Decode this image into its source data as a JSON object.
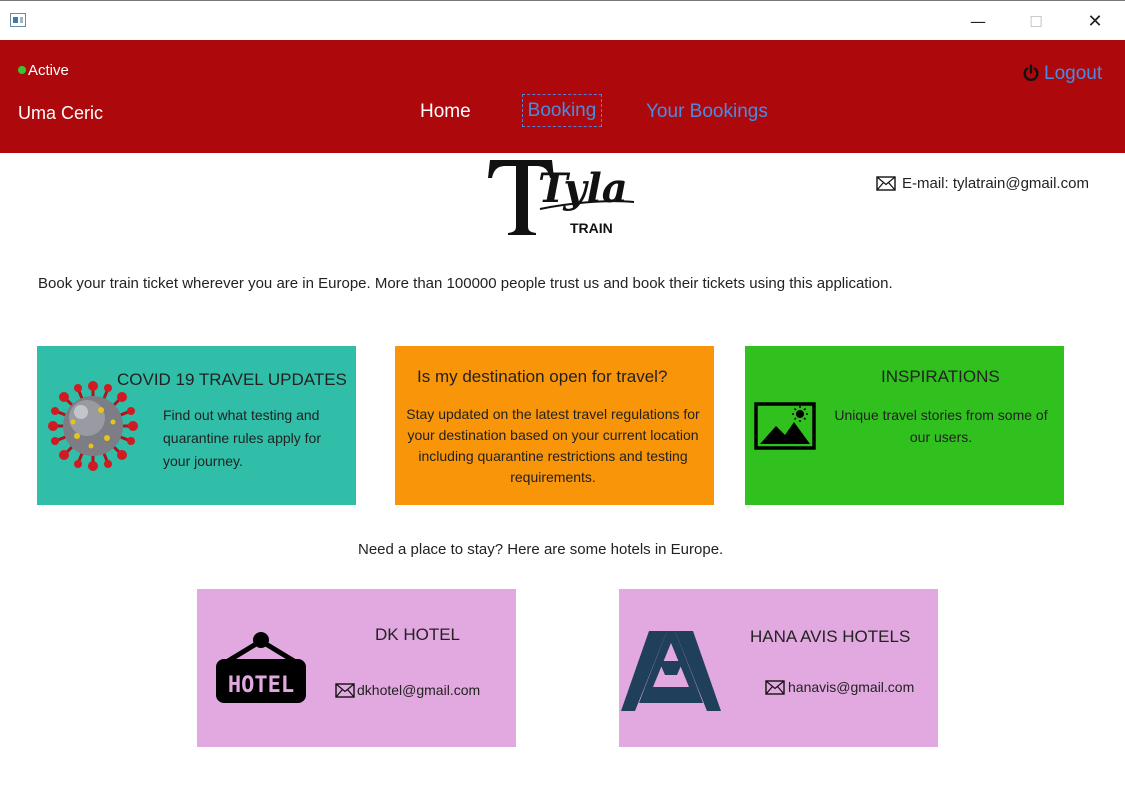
{
  "window": {
    "minimize": "—",
    "maximize": "☐",
    "close": "✕"
  },
  "header": {
    "status": "Active",
    "status_color": "#37c537",
    "username": "Uma Ceric",
    "nav": {
      "home": "Home",
      "booking": "Booking",
      "your_bookings": "Your Bookings"
    },
    "logout": "Logout",
    "background": "#ad090c",
    "link_color": "#4a8be0"
  },
  "brand": {
    "logo_main": "Tyla",
    "logo_sub": "TRAIN",
    "email": "E-mail: tylatrain@gmail.com"
  },
  "intro": "Book your train ticket wherever you are in Europe. More than 100000 people trust us and book their tickets using this application.",
  "cards": [
    {
      "title": "COVID 19 TRAVEL UPDATES",
      "text": "Find out what testing and quarantine rules apply for your journey.",
      "color": "#30bea8",
      "icon": "virus-icon"
    },
    {
      "title": "Is my destination open for travel?",
      "text": "Stay updated on the latest travel regulations for your destination based on your current location including quarantine restrictions and testing requirements.",
      "color": "#f99508"
    },
    {
      "title": "INSPIRATIONS",
      "text": "Unique travel stories from some of our users.",
      "color": "#30c11f",
      "icon": "image-icon"
    }
  ],
  "hotels_intro": "Need a place to stay? Here are some hotels in Europe.",
  "hotels": [
    {
      "name": "DK HOTEL",
      "email": "dkhotel@gmail.com",
      "logo_text": "HOTEL",
      "color": "#e2a9e0",
      "icon": "hotel-sign-icon"
    },
    {
      "name": "HANA AVIS HOTELS",
      "email": "hanavis@gmail.com",
      "color": "#e2a9e0",
      "icon": "hana-avis-logo"
    }
  ]
}
